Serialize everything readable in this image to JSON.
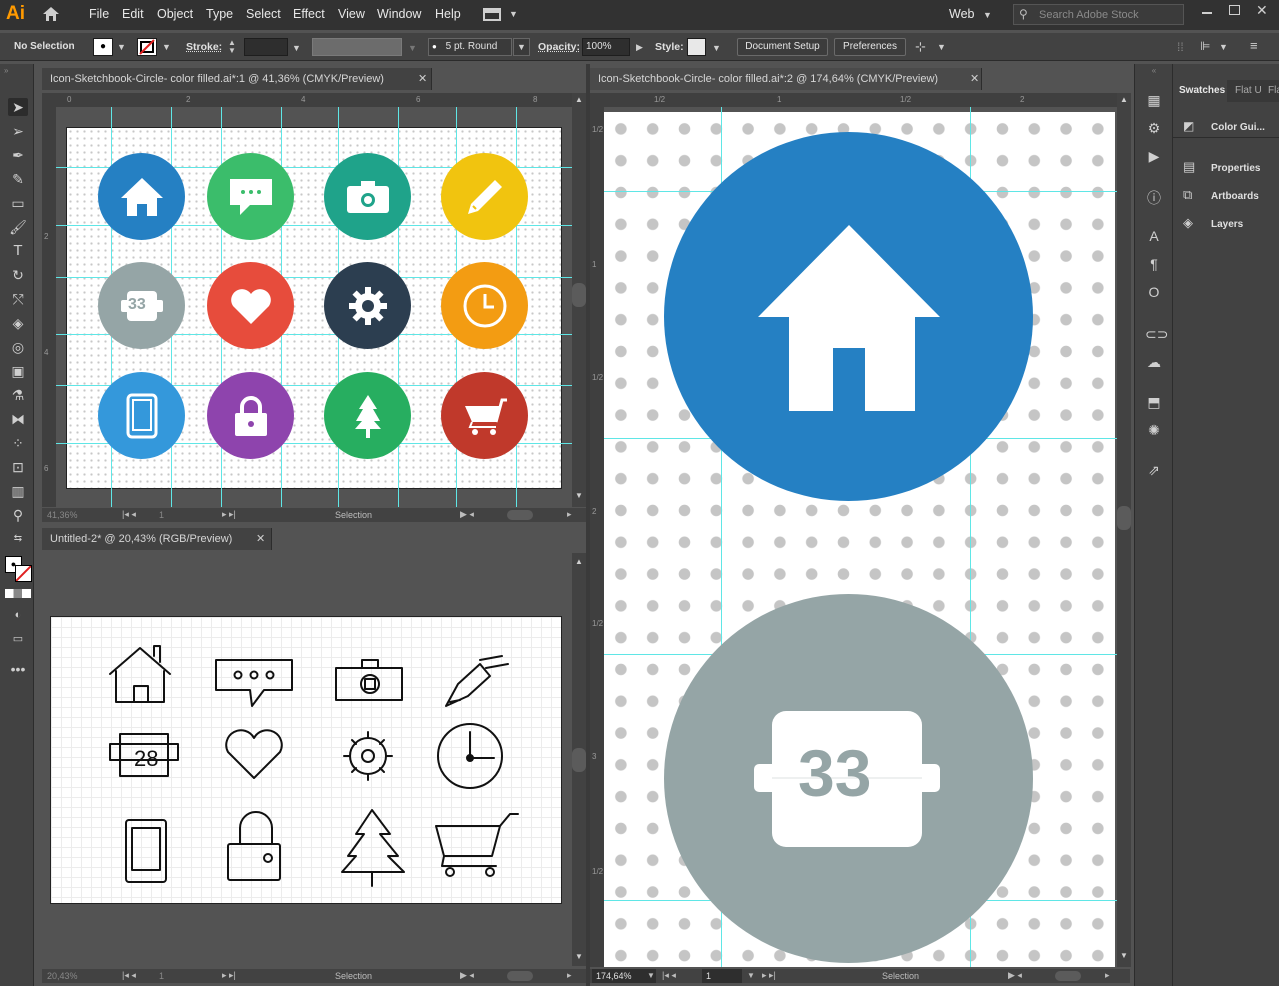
{
  "app": {
    "logo": "Ai"
  },
  "menu": [
    "File",
    "Edit",
    "Object",
    "Type",
    "Select",
    "Effect",
    "View",
    "Window",
    "Help"
  ],
  "workspace": {
    "label": "Web",
    "search_placeholder": "Search Adobe Stock"
  },
  "control_bar": {
    "selection": "No Selection",
    "stroke_label": "Stroke:",
    "brush": "5 pt. Round",
    "opacity_label": "Opacity:",
    "opacity_value": "100%",
    "style_label": "Style:",
    "doc_setup": "Document Setup",
    "preferences": "Preferences"
  },
  "doc1": {
    "tab": "Icon-Sketchbook-Circle- color filled.ai*:1 @ 41,36% (CMYK/Preview)",
    "ruler_h": [
      "0",
      "2",
      "4",
      "6",
      "8"
    ],
    "ruler_v": [
      "2",
      "4",
      "6"
    ],
    "zoom": "41,36%",
    "page": "1",
    "status": "Selection",
    "icons": [
      {
        "name": "home",
        "color": "#2580c3"
      },
      {
        "name": "chat",
        "color": "#3bbd6b"
      },
      {
        "name": "camera",
        "color": "#1fa38a"
      },
      {
        "name": "pencil",
        "color": "#f1c40f"
      },
      {
        "name": "calendar",
        "color": "#95a5a6",
        "label": "33"
      },
      {
        "name": "heart",
        "color": "#e74c3c"
      },
      {
        "name": "gear",
        "color": "#2c3e50"
      },
      {
        "name": "clock",
        "color": "#f39c12"
      },
      {
        "name": "tablet",
        "color": "#3498db"
      },
      {
        "name": "lock",
        "color": "#8e44ad"
      },
      {
        "name": "tree",
        "color": "#27ae60"
      },
      {
        "name": "cart",
        "color": "#c0392b"
      }
    ]
  },
  "doc2": {
    "tab": "Untitled-2* @ 20,43% (RGB/Preview)",
    "zoom": "20,43%",
    "page": "1",
    "status": "Selection",
    "sketch_calendar": "28"
  },
  "doc3": {
    "tab": "Icon-Sketchbook-Circle- color filled.ai*:2 @ 174,64% (CMYK/Preview)",
    "ruler_h": [
      "1/2",
      "1",
      "1/2",
      "2"
    ],
    "ruler_v": [
      "1/2",
      "1",
      "1/2",
      "2",
      "1/2",
      "3",
      "1/2"
    ],
    "zoom": "174,64%",
    "page": "1",
    "status": "Selection",
    "calendar_number": "33",
    "colors": {
      "blue": "#2580c3",
      "gray": "#95a5a6"
    }
  },
  "panels": {
    "tabs": [
      "Swatches",
      "Flat U",
      "Fla"
    ],
    "items": [
      "Color Gui...",
      "Properties",
      "Artboards",
      "Layers"
    ]
  }
}
